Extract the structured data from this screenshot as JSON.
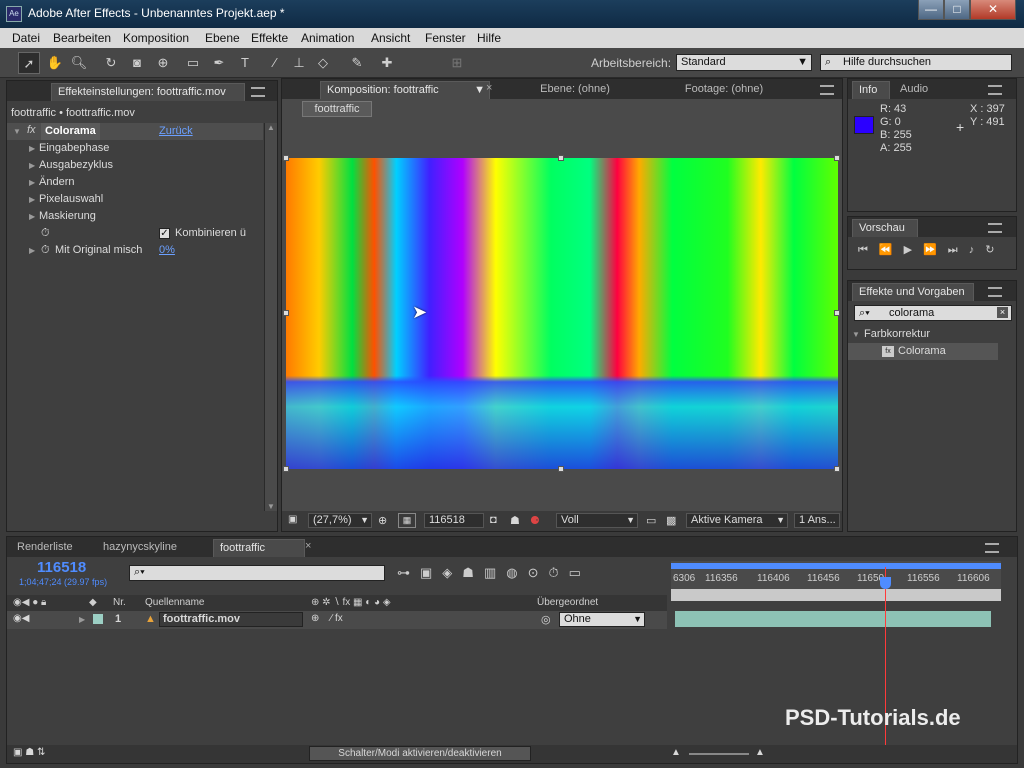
{
  "window": {
    "title": "Adobe After Effects - Unbenanntes Projekt.aep *",
    "app_icon": "Ae",
    "minimize": "—",
    "maximize": "□",
    "close": "✕"
  },
  "menu": [
    "Datei",
    "Bearbeiten",
    "Komposition",
    "Ebene",
    "Effekte",
    "Animation",
    "Ansicht",
    "Fenster",
    "Hilfe"
  ],
  "toolbar": {
    "workspace_label": "Arbeitsbereich:",
    "workspace_value": "Standard",
    "help_placeholder": "Hilfe durchsuchen"
  },
  "effect_controls": {
    "tab": "Effekteinstellungen: foottraffic.mov",
    "breadcrumb": "foottraffic • foottraffic.mov",
    "effect_name": "Colorama",
    "reset_link": "Zurück",
    "params": [
      "Eingabephase",
      "Ausgabezyklus",
      "Ändern",
      "Pixelauswahl",
      "Maskierung"
    ],
    "combine_label": "Kombinieren ü",
    "blend_label": "Mit Original misch",
    "blend_value": "0%"
  },
  "composition": {
    "tab": "Komposition: foottraffic",
    "layer_tab": "Ebene: (ohne)",
    "footage_tab": "Footage: (ohne)",
    "comp_button": "foottraffic",
    "zoom": "(27,7%)",
    "timecode": "116518",
    "resolution": "Voll",
    "camera": "Aktive Kamera",
    "views": "1 Ans..."
  },
  "info": {
    "tab": "Info",
    "audio_tab": "Audio",
    "r": "R: 43",
    "g": "G: 0",
    "b": "B: 255",
    "a": "A: 255",
    "x": "X : 397",
    "y": "Y : 491",
    "swatch_color": "#2b00ff"
  },
  "preview": {
    "tab": "Vorschau"
  },
  "effects_presets": {
    "tab": "Effekte und Vorgaben",
    "search_value": "colorama",
    "category": "Farbkorrektur",
    "item": "Colorama"
  },
  "timeline": {
    "tabs": [
      "Renderliste",
      "hazynycskyline",
      "foottraffic"
    ],
    "current_frame": "116518",
    "timecode_sub": "1;04;47;24 (29.97 fps)",
    "col_nr": "Nr.",
    "col_source": "Quellenname",
    "col_parent": "Übergeordnet",
    "layer_number": "1",
    "layer_name": "foottraffic.mov",
    "parent_value": "Ohne",
    "ruler": [
      "6306",
      "116356",
      "116406",
      "116456",
      "11650",
      "116556",
      "116606"
    ],
    "toggle_label": "Schalter/Modi aktivieren/deaktivieren"
  },
  "watermark": "PSD-Tutorials.de"
}
